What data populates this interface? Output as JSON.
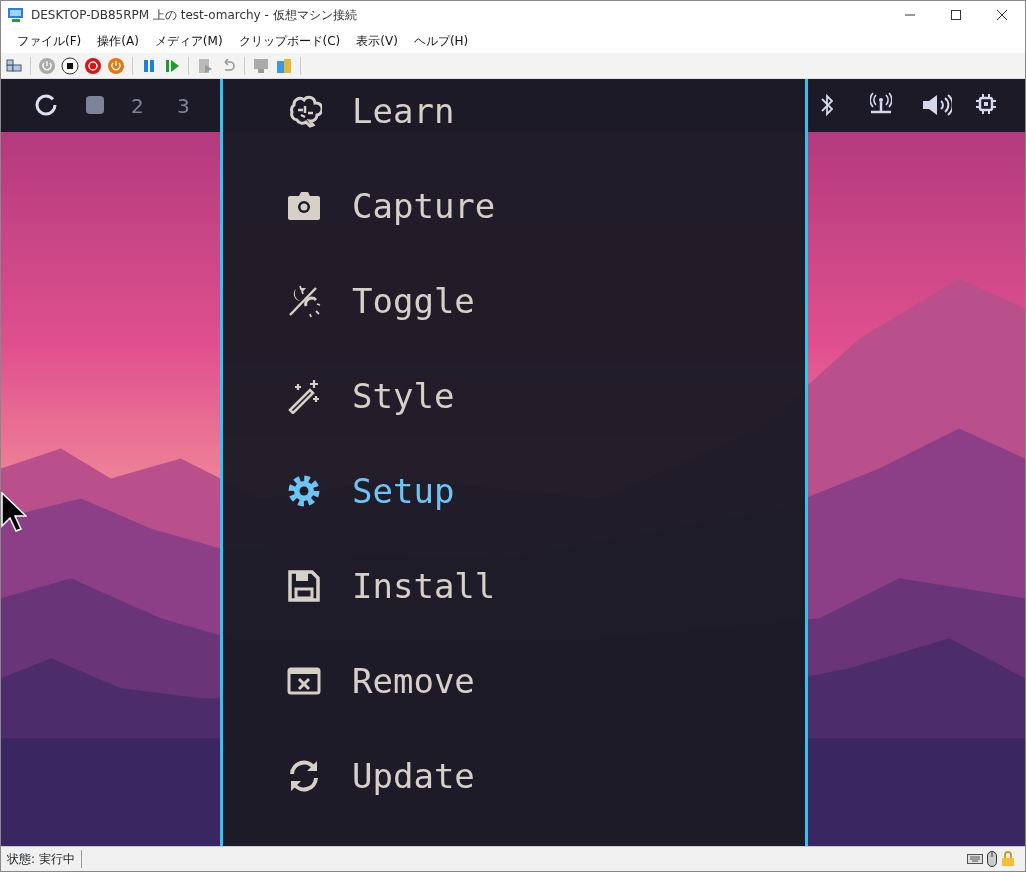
{
  "window": {
    "title": "DESKTOP-DB85RPM 上の test-omarchy  - 仮想マシン接続"
  },
  "menu_bar": [
    "ファイル(F)",
    "操作(A)",
    "メディア(M)",
    "クリップボード(C)",
    "表示(V)",
    "ヘルプ(H)"
  ],
  "top_bar": {
    "workspaces": [
      "2",
      "3"
    ]
  },
  "launcher": {
    "items": [
      {
        "label": "Learn",
        "selected": false
      },
      {
        "label": "Capture",
        "selected": false
      },
      {
        "label": "Toggle",
        "selected": false
      },
      {
        "label": "Style",
        "selected": false
      },
      {
        "label": "Setup",
        "selected": true
      },
      {
        "label": "Install",
        "selected": false
      },
      {
        "label": "Remove",
        "selected": false
      },
      {
        "label": "Update",
        "selected": false
      }
    ]
  },
  "status_bar": {
    "text": "状態: 実行中"
  }
}
